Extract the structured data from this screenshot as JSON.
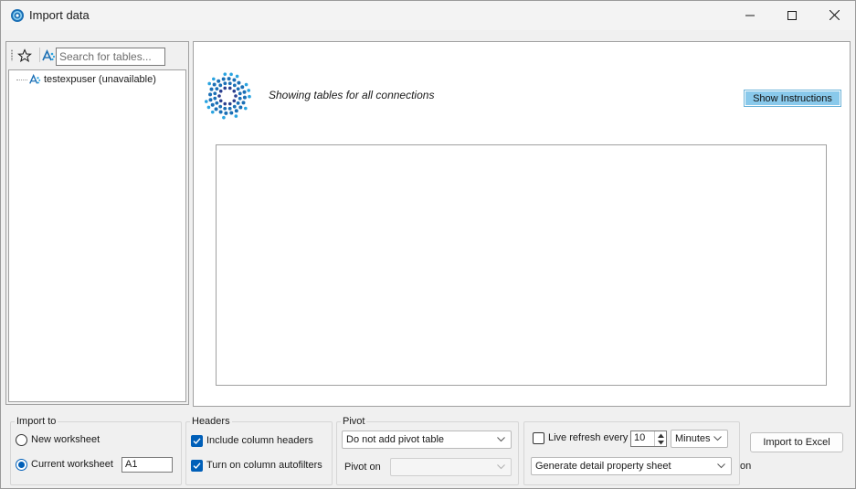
{
  "window": {
    "title": "Import data",
    "controls": {
      "minimize_icon": "minimize-icon",
      "maximize_icon": "maximize-icon",
      "close_icon": "close-icon"
    }
  },
  "left_panel": {
    "toolbar": {
      "favorites_icon": "star-icon",
      "connection_icon": "connection-icon"
    },
    "search": {
      "placeholder": "Search for tables...",
      "value": ""
    },
    "tree": [
      {
        "label": "testexpuser (unavailable)",
        "icon": "connection-icon"
      }
    ]
  },
  "main": {
    "status_text": "Showing tables for all connections",
    "show_instructions_label": "Show Instructions",
    "accent_color": "#89c9eb"
  },
  "import_to": {
    "title": "Import to",
    "options": [
      {
        "label": "New worksheet",
        "selected": false
      },
      {
        "label": "Current worksheet",
        "selected": true
      }
    ],
    "cell_value": "A1"
  },
  "headers": {
    "title": "Headers",
    "options": [
      {
        "label": "Include column headers",
        "checked": true
      },
      {
        "label": "Turn on column autofilters",
        "checked": true
      }
    ]
  },
  "pivot": {
    "title": "Pivot",
    "pivot_select": "Do not add pivot table",
    "pivot_on_label": "Pivot on",
    "pivot_on_value": ""
  },
  "refresh": {
    "live_refresh_label": "Live refresh every",
    "live_refresh_checked": false,
    "interval_value": "10",
    "unit_value": "Minutes",
    "detail_select": "Generate detail property sheet",
    "detail_suffix": "on"
  },
  "actions": {
    "import_label": "Import to Excel"
  },
  "colors": {
    "brand_blue": "#1b6fb5",
    "check_blue": "#005fb8"
  }
}
